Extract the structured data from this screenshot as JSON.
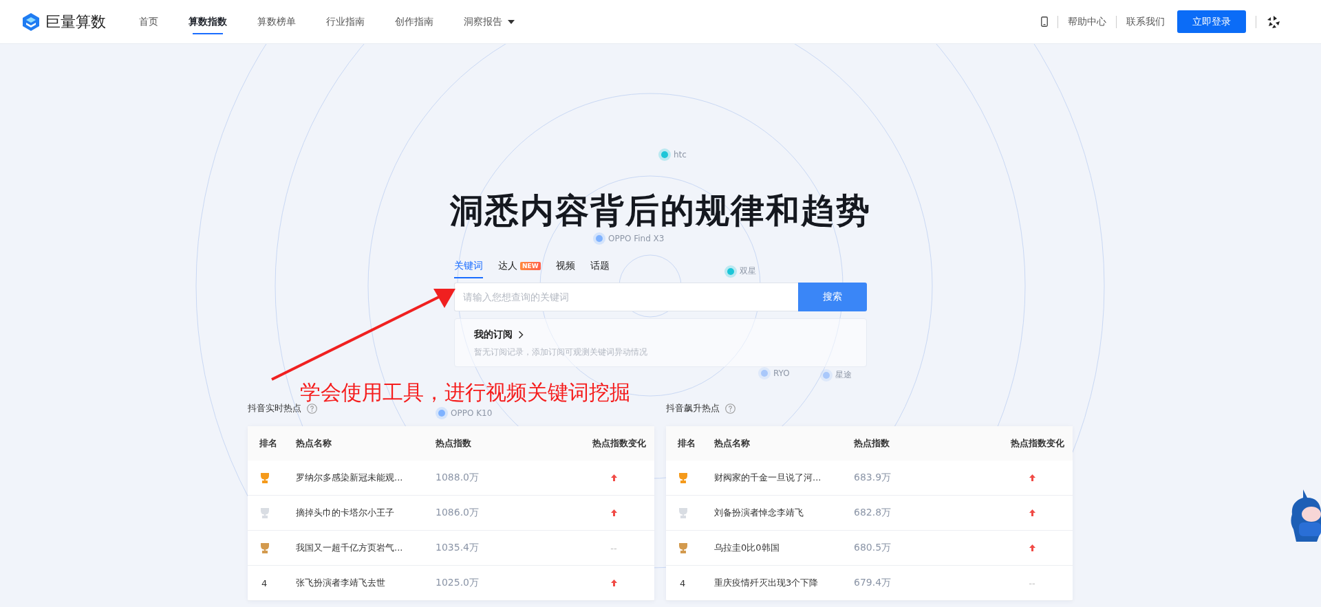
{
  "header": {
    "logo": "巨量算数",
    "nav": [
      {
        "label": "首页",
        "selected": false,
        "dropdown": false
      },
      {
        "label": "算数指数",
        "selected": true,
        "dropdown": false
      },
      {
        "label": "算数榜单",
        "selected": false,
        "dropdown": false
      },
      {
        "label": "行业指南",
        "selected": false,
        "dropdown": false
      },
      {
        "label": "创作指南",
        "selected": false,
        "dropdown": false
      },
      {
        "label": "洞察报告",
        "selected": false,
        "dropdown": true
      }
    ],
    "links": [
      "帮助中心",
      "联系我们"
    ],
    "login": "立即登录"
  },
  "radar_points": [
    {
      "label": "htc",
      "color": "#1cc6d8"
    },
    {
      "label": "OPPO Find X3",
      "color": "#7fb2ff"
    },
    {
      "label": "双星",
      "color": "#1cc6d8"
    },
    {
      "label": "RYO",
      "color": "#a9c8fb"
    },
    {
      "label": "星途",
      "color": "#a9c8fb"
    },
    {
      "label": "OPPO K10",
      "color": "#7fb2ff"
    }
  ],
  "hero": {
    "title": "洞悉内容背后的规律和趋势",
    "tabs": [
      {
        "label": "关键词",
        "selected": true
      },
      {
        "label": "达人",
        "selected": false,
        "badge": "NEW"
      },
      {
        "label": "视频",
        "selected": false
      },
      {
        "label": "话题",
        "selected": false
      }
    ],
    "search": {
      "placeholder": "请输入您想查询的关键词",
      "button": "搜索"
    },
    "subscription": {
      "title": "我的订阅",
      "note": "暂无订阅记录，添加订阅可观测关键词异动情况"
    }
  },
  "annotation": {
    "text": "学会使用工具，进行视频关键词挖掘"
  },
  "panels": [
    {
      "title": "抖音实时热点",
      "columns": [
        "排名",
        "热点名称",
        "热点指数",
        "热点指数变化"
      ],
      "rows": [
        {
          "rank": {
            "kind": "trophy",
            "color": "#f59a1b"
          },
          "name": "罗纳尔多感染新冠未能观...",
          "index": "1088.0万",
          "change": {
            "kind": "up"
          }
        },
        {
          "rank": {
            "kind": "trophy",
            "color": "#d9dde3"
          },
          "name": "摘掉头巾的卡塔尔小王子",
          "index": "1086.0万",
          "change": {
            "kind": "up"
          }
        },
        {
          "rank": {
            "kind": "trophy",
            "color": "#d39a4e"
          },
          "name": "我国又一超千亿方页岩气...",
          "index": "1035.4万",
          "change": {
            "kind": "flat",
            "text": "--"
          }
        },
        {
          "rank": {
            "kind": "number",
            "text": "4"
          },
          "name": "张飞扮演者李靖飞去世",
          "index": "1025.0万",
          "change": {
            "kind": "up"
          }
        }
      ]
    },
    {
      "title": "抖音飙升热点",
      "columns": [
        "排名",
        "热点名称",
        "热点指数",
        "热点指数变化"
      ],
      "rows": [
        {
          "rank": {
            "kind": "trophy",
            "color": "#f59a1b"
          },
          "name": "财阀家的千金一旦说了河...",
          "index": "683.9万",
          "change": {
            "kind": "up"
          }
        },
        {
          "rank": {
            "kind": "trophy",
            "color": "#d9dde3"
          },
          "name": "刘备扮演者悼念李靖飞",
          "index": "682.8万",
          "change": {
            "kind": "up"
          }
        },
        {
          "rank": {
            "kind": "trophy",
            "color": "#d39a4e"
          },
          "name": "乌拉圭0比0韩国",
          "index": "680.5万",
          "change": {
            "kind": "up"
          }
        },
        {
          "rank": {
            "kind": "number",
            "text": "4"
          },
          "name": "重庆疫情歼灭出现3个下降",
          "index": "679.4万",
          "change": {
            "kind": "flat",
            "text": "--"
          }
        }
      ]
    }
  ]
}
